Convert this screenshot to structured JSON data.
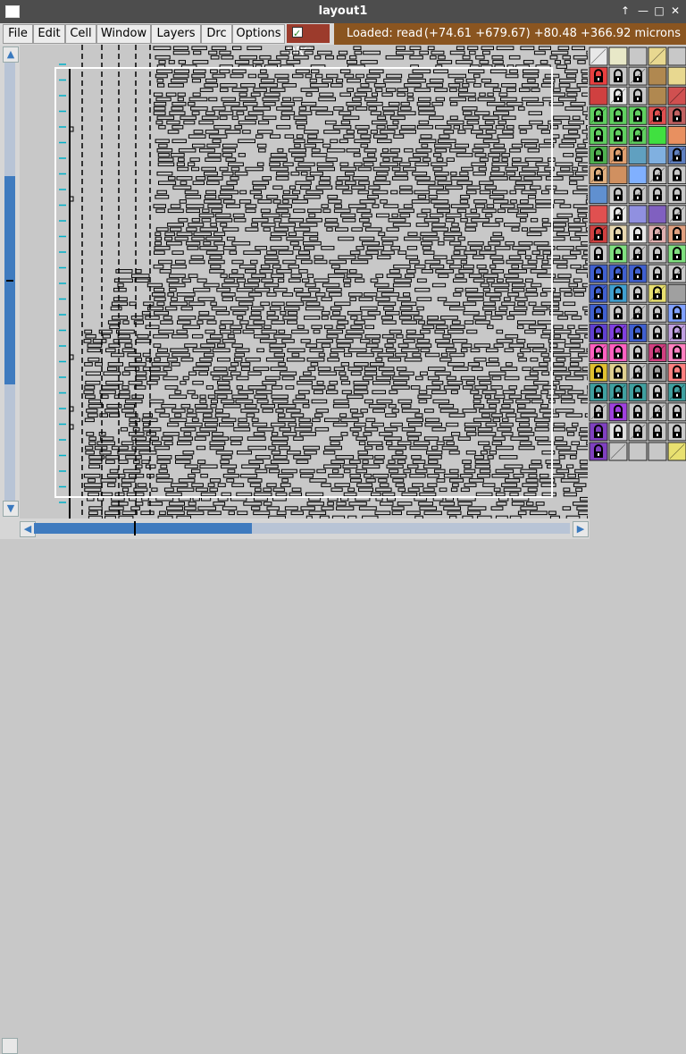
{
  "window": {
    "title": "layout1"
  },
  "menu": {
    "items": [
      "File",
      "Edit",
      "Cell",
      "Window",
      "Layers",
      "Drc",
      "Options"
    ]
  },
  "drc": {
    "label": "DRC",
    "checked": true
  },
  "status": {
    "loaded": "Loaded: read",
    "coords": "(+74.61 +679.67) +80.48 +366.92 microns"
  },
  "scroll": {
    "vertical_position": 0.27,
    "vertical_visible": 0.47,
    "horizontal_position": 0.0,
    "horizontal_visible": 0.41
  },
  "colors": {
    "title_bg": "#4d4d4d",
    "status_bg": "#8a5520",
    "drc_bg": "#9c3b2c",
    "scroll_thumb": "#3f7bbf",
    "canvas_bg": "#c8c8c8",
    "box_outline": "#ffffff"
  },
  "icons": {
    "title_left": "window-icon",
    "title_buttons": [
      "arrow-up-icon",
      "minimize-icon",
      "maximize-icon",
      "close-icon"
    ]
  }
}
